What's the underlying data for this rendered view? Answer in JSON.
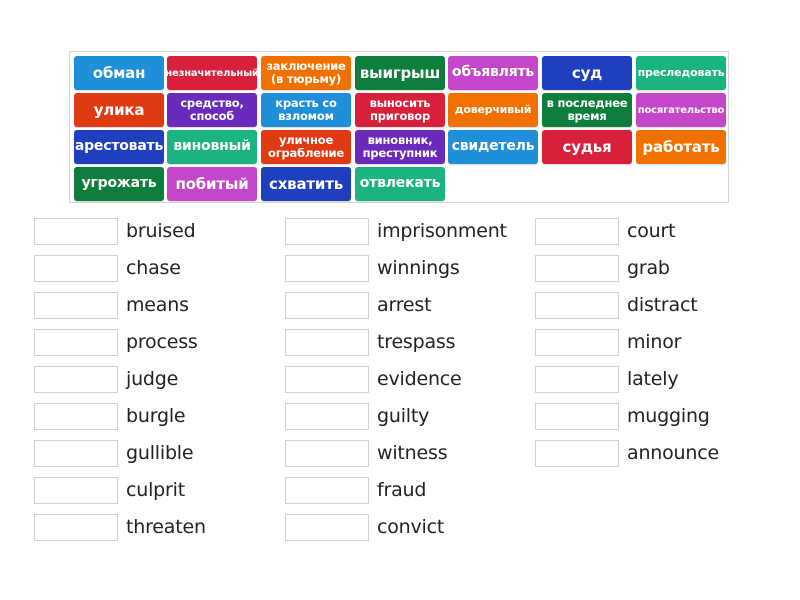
{
  "tiles": [
    {
      "label": "обман",
      "color": "#1e8fd8",
      "size": "big"
    },
    {
      "label": "незначительный",
      "color": "#d9203a",
      "size": "tiny"
    },
    {
      "label": "заключение (в тюрьму)",
      "color": "#f07000",
      "size": "two"
    },
    {
      "label": "выигрыш",
      "color": "#0f7d3c",
      "size": "big"
    },
    {
      "label": "объявлять",
      "color": "#c447c9",
      "size": "med"
    },
    {
      "label": "суд",
      "color": "#1f3fbf",
      "size": "big"
    },
    {
      "label": "преследовать",
      "color": "#1ab381",
      "size": "small"
    },
    {
      "label": "улика",
      "color": "#e03a12",
      "size": "big"
    },
    {
      "label": "средство, способ",
      "color": "#6a2bbd",
      "size": "two"
    },
    {
      "label": "красть со взломом",
      "color": "#1e8fd8",
      "size": "two"
    },
    {
      "label": "выносить приговор",
      "color": "#d9203a",
      "size": "two"
    },
    {
      "label": "доверчивый",
      "color": "#f07000",
      "size": "small"
    },
    {
      "label": "в последнее время",
      "color": "#0f7d3c",
      "size": "two"
    },
    {
      "label": "посягательство",
      "color": "#c447c9",
      "size": "tiny"
    },
    {
      "label": "арестовать",
      "color": "#1f3fbf",
      "size": "med"
    },
    {
      "label": "виновный",
      "color": "#1ab381",
      "size": "med"
    },
    {
      "label": "уличное ограбление",
      "color": "#e03a12",
      "size": "two"
    },
    {
      "label": "виновник, преступник",
      "color": "#6a2bbd",
      "size": "two"
    },
    {
      "label": "свидетель",
      "color": "#1e8fd8",
      "size": "med"
    },
    {
      "label": "судья",
      "color": "#d9203a",
      "size": "big"
    },
    {
      "label": "работать",
      "color": "#f07000",
      "size": "big"
    },
    {
      "label": "угрожать",
      "color": "#0f7d3c",
      "size": "med"
    },
    {
      "label": "побитый",
      "color": "#c447c9",
      "size": "big"
    },
    {
      "label": "схватить",
      "color": "#1f3fbf",
      "size": "big"
    },
    {
      "label": "отвлекать",
      "color": "#1ab381",
      "size": "med"
    }
  ],
  "prompts": {
    "col1": [
      "bruised",
      "chase",
      "means",
      "process",
      "judge",
      "burgle",
      "gullible",
      "culprit",
      "threaten"
    ],
    "col2": [
      "imprisonment",
      "winnings",
      "arrest",
      "trespass",
      "evidence",
      "guilty",
      "witness",
      "fraud",
      "convict"
    ],
    "col3": [
      "court",
      "grab",
      "distract",
      "minor",
      "lately",
      "mugging",
      "announce"
    ]
  }
}
